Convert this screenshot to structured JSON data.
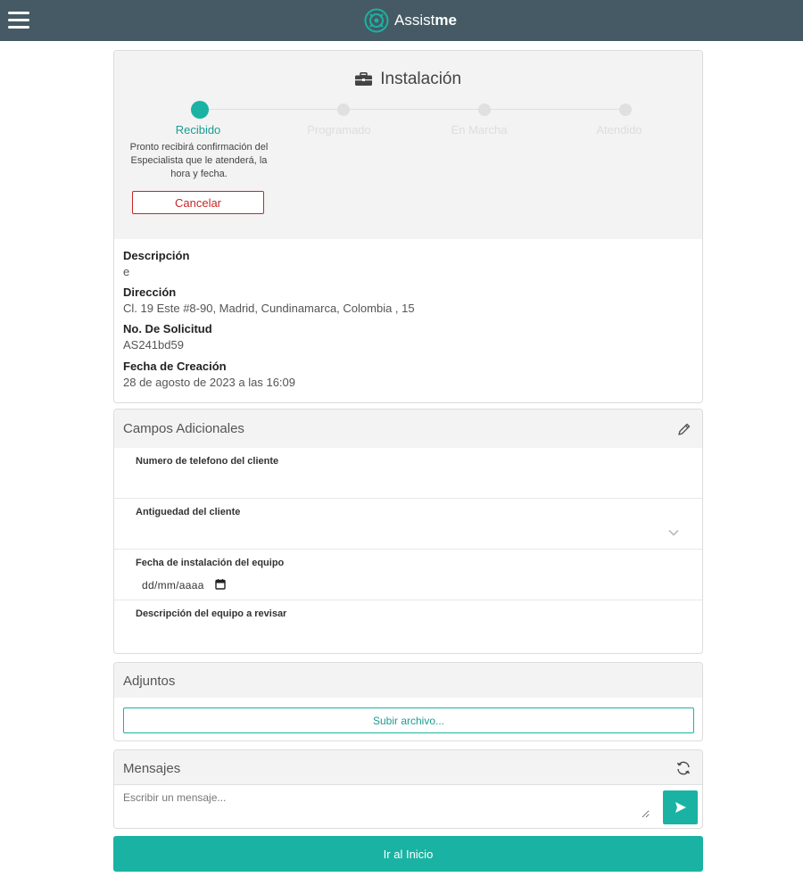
{
  "header": {
    "brand_light": "Assist",
    "brand_bold": "me",
    "menu_icon": "hamburger-menu-icon",
    "logo_icon": "assistme-logo-icon"
  },
  "request": {
    "title": "Instalación",
    "title_icon": "briefcase-icon",
    "steps": [
      {
        "label": "Recibido",
        "active": true
      },
      {
        "label": "Programado",
        "active": false
      },
      {
        "label": "En Marcha",
        "active": false
      },
      {
        "label": "Atendido",
        "active": false
      }
    ],
    "step_description": "Pronto recibirá confirmación del Especialista que le atenderá, la hora y fecha.",
    "cancel_label": "Cancelar",
    "fields": [
      {
        "label": "Descripción",
        "value": "e"
      },
      {
        "label": "Dirección",
        "value": "Cl. 19 Este #8-90, Madrid, Cundinamarca, Colombia , 15"
      },
      {
        "label": "No. De Solicitud",
        "value": "AS241bd59"
      },
      {
        "label": "Fecha de Creación",
        "value": "28 de agosto de 2023 a las 16:09"
      }
    ]
  },
  "additional": {
    "title": "Campos Adicionales",
    "edit_icon": "pencil-icon",
    "fields": [
      {
        "label": "Numero de telefono del cliente",
        "value": ""
      },
      {
        "label": "Antiguedad del cliente",
        "value": ""
      },
      {
        "label": "Fecha de instalación del equipo",
        "value": "dd/mm/aaaa"
      },
      {
        "label": "Descripción del equipo a revisar",
        "value": ""
      }
    ]
  },
  "attachments": {
    "title": "Adjuntos",
    "upload_label": "Subir archivo..."
  },
  "messages": {
    "title": "Mensajes",
    "refresh_icon": "refresh-icon",
    "placeholder": "Escribir un mensaje...",
    "send_icon": "send-icon"
  },
  "footer": {
    "home_label": "Ir al Inicio"
  },
  "colors": {
    "topbar": "#455a64",
    "accent": "#1ab3a3",
    "danger": "#c62828"
  }
}
